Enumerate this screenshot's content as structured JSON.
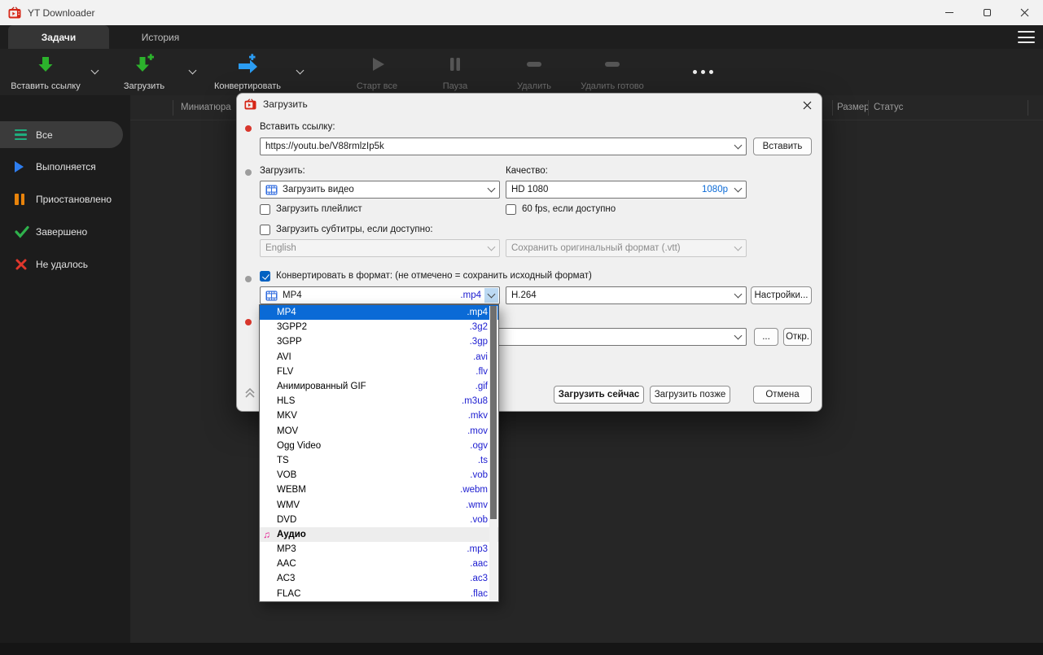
{
  "titlebar": {
    "title": "YT Downloader"
  },
  "tabs": {
    "tasks": "Задачи",
    "history": "История"
  },
  "toolbar": {
    "paste_link": "Вставить ссылку",
    "download": "Загрузить",
    "convert": "Конвертировать",
    "start_all": "Старт все",
    "pause": "Пауза",
    "delete": "Удалить",
    "delete_done": "Удалить готово"
  },
  "sidebar": {
    "items": [
      {
        "label": "Все",
        "selected": true
      },
      {
        "label": "Выполняется"
      },
      {
        "label": "Приостановлено"
      },
      {
        "label": "Завершено"
      },
      {
        "label": "Не удалось"
      }
    ]
  },
  "list": {
    "col_thumbnail": "Миниатюра",
    "col_size": "Размер",
    "col_status": "Статус"
  },
  "dialog": {
    "title": "Загрузить",
    "link_label": "Вставить ссылку:",
    "url": "https://youtu.be/V88rmlzIp5k",
    "paste_button": "Вставить",
    "download_label": "Загрузить:",
    "quality_label": "Качество:",
    "download_mode": "Загрузить видео",
    "quality_value": "HD 1080",
    "quality_tag": "1080p",
    "playlist_checkbox": "Загрузить плейлист",
    "fps_checkbox": "60 fps, если доступно",
    "subtitles_checkbox": "Загрузить субтитры, если доступно:",
    "subtitle_language": "English",
    "subtitle_format": "Сохранить оригинальный формат (.vtt)",
    "convert_checkbox": "Конвертировать в формат: (не отмечено = сохранить исходный формат)",
    "format_value": "MP4",
    "format_ext": ".mp4",
    "codec_value": "H.264",
    "settings_button": "Настройки...",
    "browse_button": "...",
    "open_button": "Откр.",
    "download_now_button": "Загрузить сейчас",
    "download_later_button": "Загрузить позже",
    "cancel_button": "Отмена"
  },
  "format_dropdown": {
    "items": [
      {
        "name": "MP4",
        "ext": ".mp4",
        "selected": true
      },
      {
        "name": "3GPP2",
        "ext": ".3g2"
      },
      {
        "name": "3GPP",
        "ext": ".3gp"
      },
      {
        "name": "AVI",
        "ext": ".avi"
      },
      {
        "name": "FLV",
        "ext": ".flv"
      },
      {
        "name": "Анимированный GIF",
        "ext": ".gif"
      },
      {
        "name": "HLS",
        "ext": ".m3u8"
      },
      {
        "name": "MKV",
        "ext": ".mkv"
      },
      {
        "name": "MOV",
        "ext": ".mov"
      },
      {
        "name": "Ogg Video",
        "ext": ".ogv"
      },
      {
        "name": "TS",
        "ext": ".ts"
      },
      {
        "name": "VOB",
        "ext": ".vob"
      },
      {
        "name": "WEBM",
        "ext": ".webm"
      },
      {
        "name": "WMV",
        "ext": ".wmv"
      },
      {
        "name": "DVD",
        "ext": ".vob"
      },
      {
        "name": "Аудио",
        "header": true,
        "icon": "music"
      },
      {
        "name": "MP3",
        "ext": ".mp3"
      },
      {
        "name": "AAC",
        "ext": ".aac"
      },
      {
        "name": "AC3",
        "ext": ".ac3"
      },
      {
        "name": "FLAC",
        "ext": ".flac"
      }
    ]
  },
  "colors": {
    "accent_blue": "#0a6ad6",
    "extension_blue": "#1c1cd0",
    "green": "#2cb22c",
    "orange": "#e8830b",
    "red": "#d8362c"
  }
}
